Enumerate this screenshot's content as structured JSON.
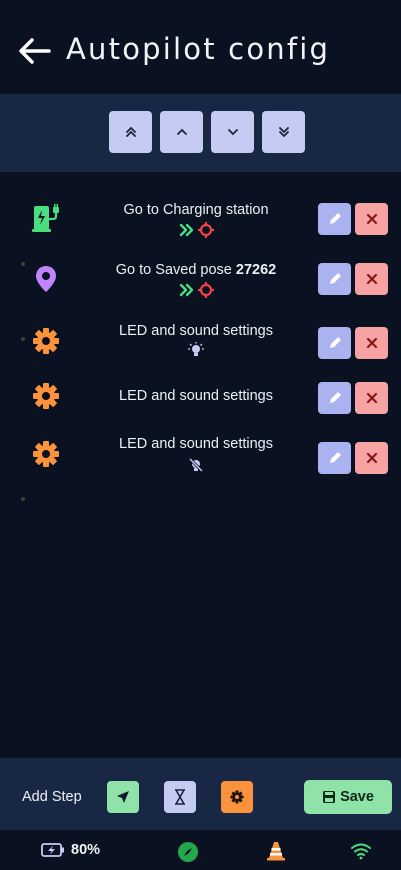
{
  "header": {
    "title": "Autopilot config",
    "back_icon": "arrow-left-icon"
  },
  "reorder": {
    "buttons": [
      {
        "name": "move-to-top-button",
        "icon": "double-chevron-up-icon"
      },
      {
        "name": "move-up-button",
        "icon": "chevron-up-icon"
      },
      {
        "name": "move-down-button",
        "icon": "chevron-down-icon"
      },
      {
        "name": "move-to-bottom-button",
        "icon": "double-chevron-down-icon"
      }
    ]
  },
  "steps": [
    {
      "label": "Go to Charging station",
      "label_bold": "",
      "icon": "charging-station-icon",
      "sub_icons": [
        "double-chevron-right-icon",
        "crosshair-icon"
      ]
    },
    {
      "label": "Go to Saved pose ",
      "label_bold": "27262",
      "icon": "map-pin-icon",
      "sub_icons": [
        "double-chevron-right-icon",
        "crosshair-icon"
      ]
    },
    {
      "label": "LED and sound settings",
      "label_bold": "",
      "icon": "gear-icon",
      "sub_icons": [
        "bulb-on-icon"
      ]
    },
    {
      "label": "LED and sound settings",
      "label_bold": "",
      "icon": "gear-icon",
      "sub_icons": []
    },
    {
      "label": "LED and sound settings",
      "label_bold": "",
      "icon": "gear-icon",
      "sub_icons": [
        "bulb-off-icon"
      ]
    }
  ],
  "footer": {
    "add_step_label": "Add Step",
    "add_buttons": [
      {
        "name": "add-navigate-step-button",
        "icon": "navigation-arrow-icon"
      },
      {
        "name": "add-wait-step-button",
        "icon": "hourglass-icon"
      },
      {
        "name": "add-settings-step-button",
        "icon": "gear-icon"
      }
    ],
    "save_label": "Save"
  },
  "status": {
    "battery": "80%",
    "icons": [
      "battery-charging-icon",
      "compass-icon",
      "traffic-cone-icon",
      "wifi-icon"
    ]
  },
  "colors": {
    "background": "#0a1120",
    "bar": "#172744",
    "edit": "#aab3f0",
    "delete": "#f7a3a3",
    "green": "#4ade80",
    "orange": "#fb923c",
    "purple": "#c084fc",
    "red": "#ef4444"
  }
}
